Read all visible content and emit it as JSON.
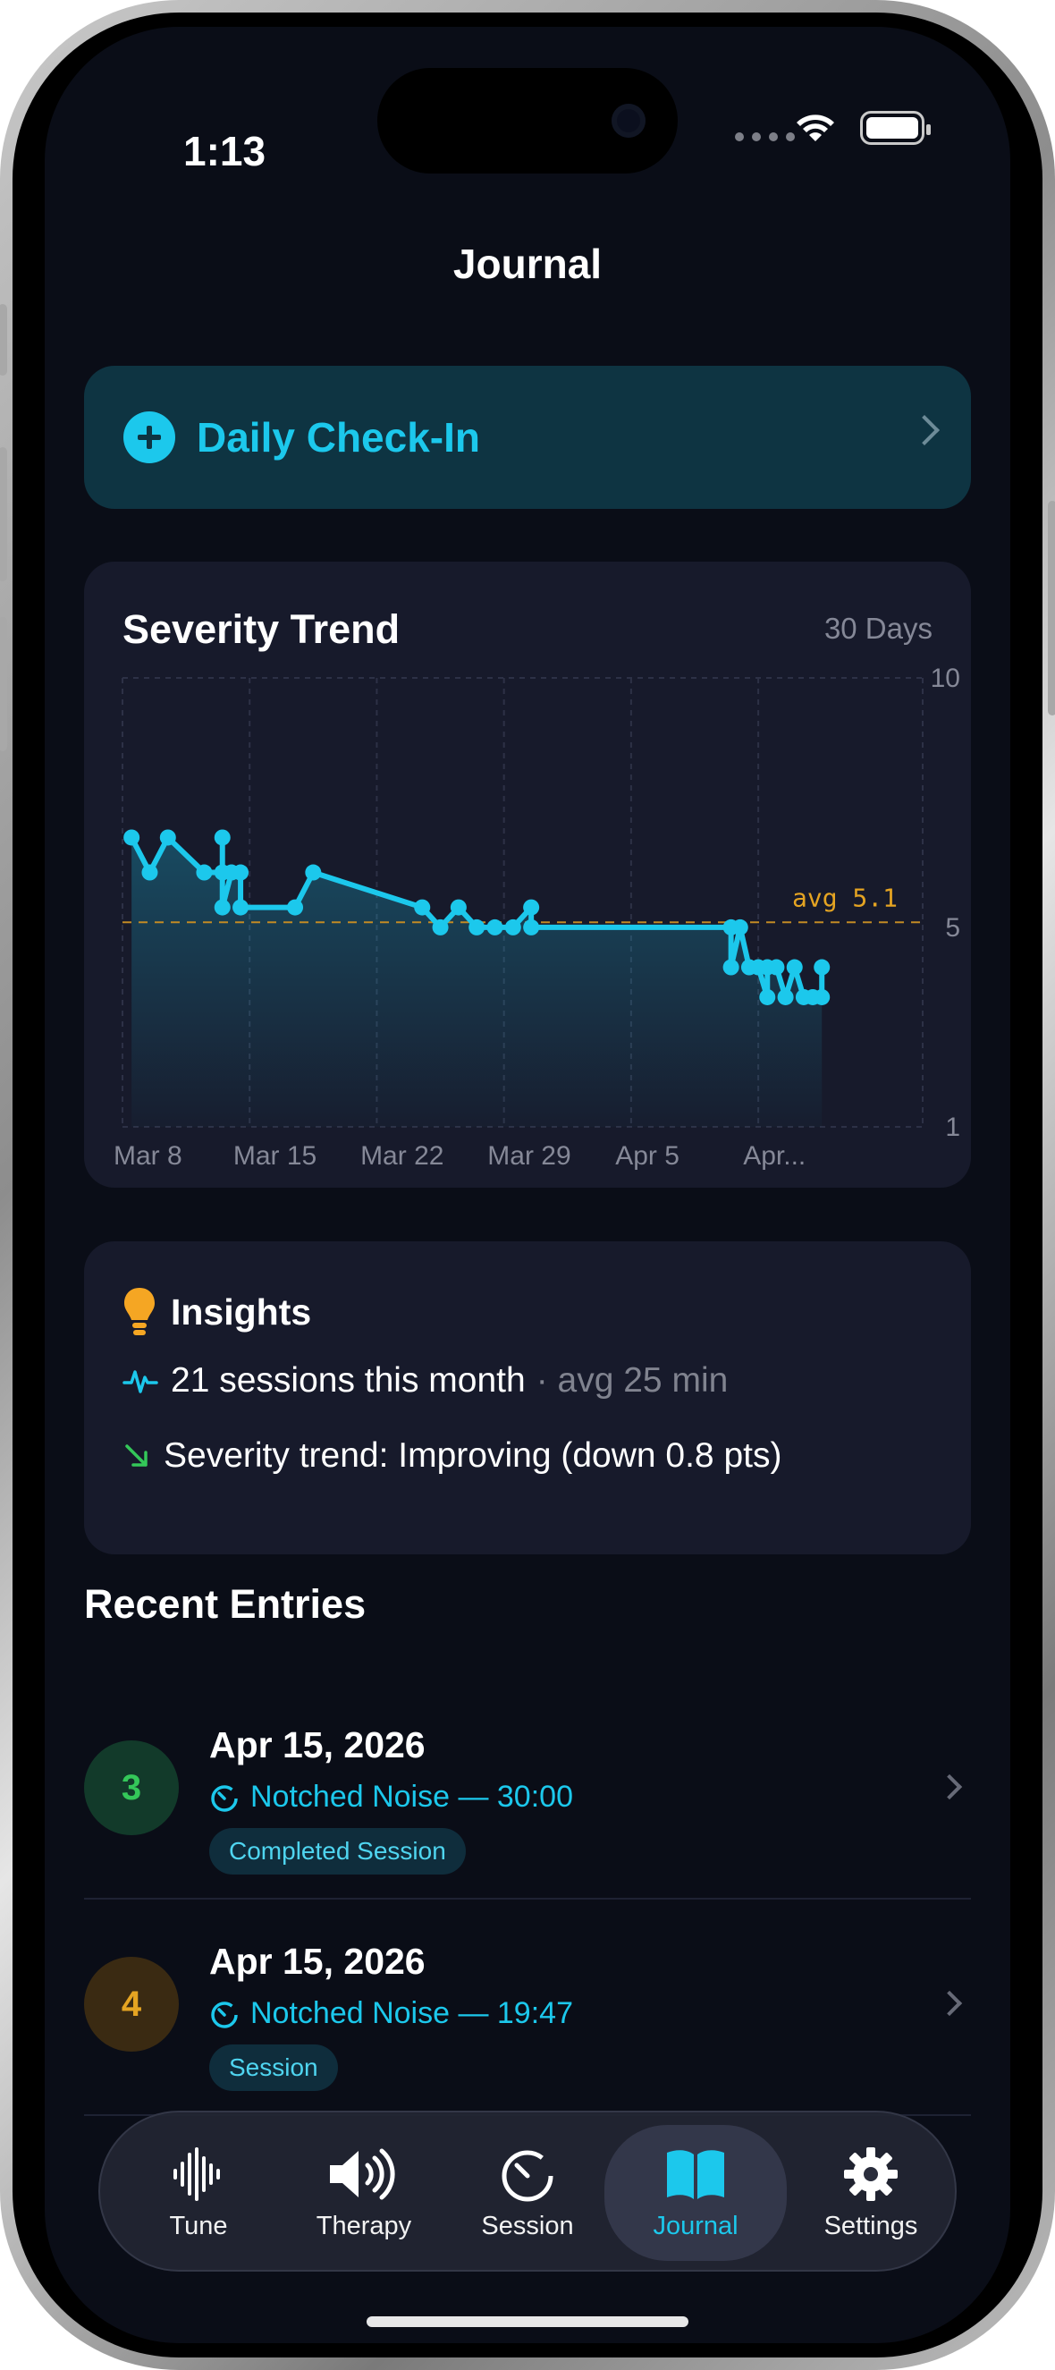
{
  "status_bar": {
    "time": "1:13"
  },
  "nav": {
    "title": "Journal"
  },
  "checkin": {
    "label": "Daily Check-In",
    "icon": "plus-circle-icon"
  },
  "trend": {
    "title": "Severity Trend",
    "range": "30 Days",
    "colors": {
      "line": "#1cc8ec",
      "avg": "#e5a422"
    }
  },
  "chart_data": {
    "type": "line",
    "title": "Severity Trend",
    "x_ticks": [
      "Mar 8",
      "Mar 15",
      "Mar 22",
      "Mar 29",
      "Apr 5",
      "Apr..."
    ],
    "y_ticks": [
      "10",
      "5",
      "1"
    ],
    "ylim": [
      1,
      10
    ],
    "x_unit": "day offset from Mar 7 (0..40)",
    "grid": true,
    "avg": 5.1,
    "avg_label": "avg 5.1",
    "x": [
      0.5,
      1.5,
      2.5,
      4.5,
      5.5,
      5.5,
      5.5,
      6,
      6.5,
      6.5,
      9.5,
      10.5,
      16.5,
      17.5,
      18.5,
      19.5,
      20.5,
      21.5,
      22.5,
      22.5,
      33.5,
      33.5,
      34,
      34.5,
      35,
      35.5,
      35.5,
      36,
      36.5,
      37,
      37.5,
      38,
      38.5,
      38.5
    ],
    "values": [
      6.8,
      6.1,
      6.8,
      6.1,
      6.1,
      6.8,
      5.4,
      6.1,
      6.1,
      5.4,
      5.4,
      6.1,
      5.4,
      5.0,
      5.4,
      5.0,
      5.0,
      5.0,
      5.4,
      5.0,
      5.0,
      4.2,
      5.0,
      4.2,
      4.2,
      3.6,
      4.2,
      4.2,
      3.6,
      4.2,
      3.6,
      3.6,
      3.6,
      4.2
    ]
  },
  "insights": {
    "title": "Insights",
    "sessions": "21 sessions this month",
    "avg_duration": "· avg 25 min",
    "trend_text": "Severity trend: Improving (down 0.8 pts)"
  },
  "recent": {
    "title": "Recent Entries",
    "entries": [
      {
        "score": "3",
        "date": "Apr 15, 2026",
        "session": "Notched Noise — 30:00",
        "tag": "Completed Session",
        "badge_bg": "#123a2a",
        "badge_fg": "#34c759"
      },
      {
        "score": "4",
        "date": "Apr 15, 2026",
        "session": "Notched Noise — 19:47",
        "tag": "Session",
        "badge_bg": "#3a2a12",
        "badge_fg": "#e5a422"
      }
    ]
  },
  "tabs": [
    {
      "label": "Tune",
      "icon": "waveform-icon"
    },
    {
      "label": "Therapy",
      "icon": "speaker-wave-icon"
    },
    {
      "label": "Session",
      "icon": "timer-icon"
    },
    {
      "label": "Journal",
      "icon": "book-icon",
      "active": true
    },
    {
      "label": "Settings",
      "icon": "gear-icon"
    }
  ]
}
